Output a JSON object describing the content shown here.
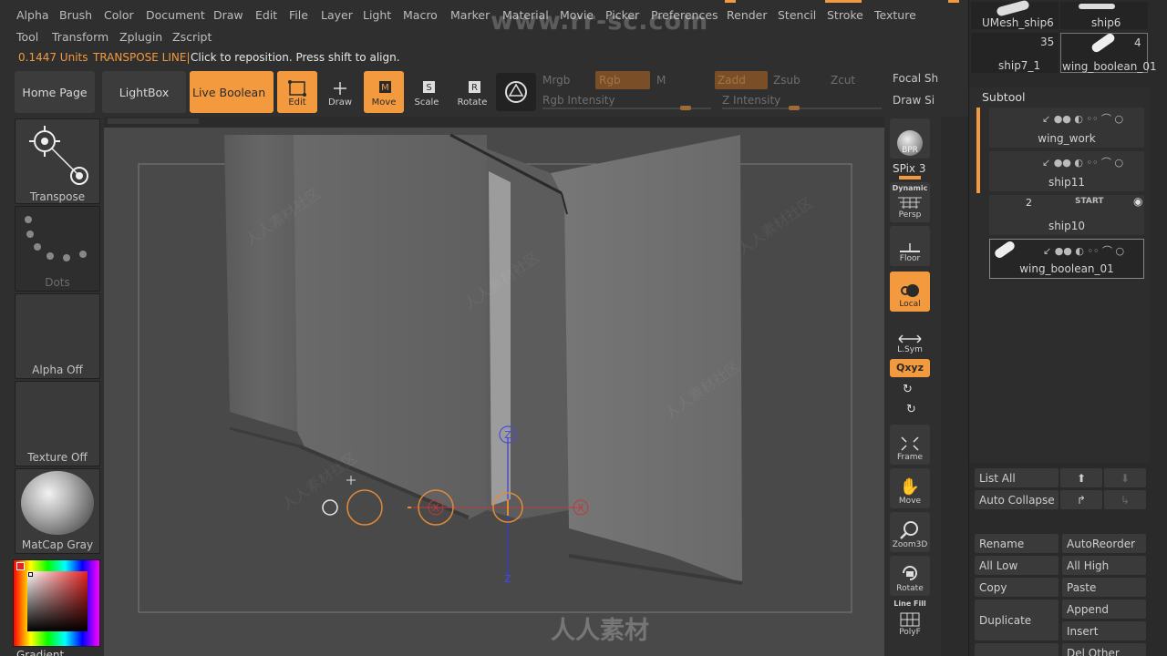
{
  "menu": {
    "row1": [
      "Alpha",
      "Brush",
      "Color",
      "Document",
      "Draw",
      "Edit",
      "File",
      "Layer",
      "Light",
      "Macro",
      "Marker",
      "Material",
      "Movie",
      "Picker",
      "Preferences",
      "Render",
      "Stencil",
      "Stroke",
      "Texture"
    ],
    "row2": [
      "Tool",
      "Transform",
      "Zplugin",
      "Zscript"
    ],
    "focal_label": "Focal Sh",
    "draw_size_label": "Draw Si"
  },
  "status": {
    "units": "0.1447 Units",
    "mode": "TRANSPOSE LINE|",
    "hint": "Click to reposition. Press shift to align."
  },
  "toolbar": {
    "home_page": "Home Page",
    "lightbox": "LightBox",
    "live_boolean": "Live Boolean",
    "edit": "Edit",
    "draw": "Draw",
    "move": "Move",
    "scale": "Scale",
    "rotate": "Rotate",
    "mrgb": "Mrgb",
    "rgb": "Rgb",
    "m": "M",
    "zadd": "Zadd",
    "zsub": "Zsub",
    "zcut": "Zcut",
    "rgb_intensity": "Rgb Intensity",
    "z_intensity": "Z Intensity",
    "rgb_intensity_level": 0.85,
    "z_intensity_level": 0.45
  },
  "left_shelf": {
    "transpose": "Transpose",
    "dots": "Dots",
    "alpha": "Alpha Off",
    "texture": "Texture Off",
    "matcap": "MatCap Gray",
    "gradient": "Gradient"
  },
  "right_shelf": {
    "bpr": "BPR",
    "spix": "SPix 3",
    "dynamic": "Dynamic",
    "persp": "Persp",
    "floor": "Floor",
    "local": "Local",
    "lsym": "L.Sym",
    "xyz": "Qxyz",
    "frame": "Frame",
    "move": "Move",
    "zoom3d": "Zoom3D",
    "rotate": "Rotate",
    "line_fill": "Line Fill",
    "polyf": "PolyF"
  },
  "viewport": {
    "axis_z_top": "Z",
    "axis_z_bottom": "Z",
    "axis_x_left": "X",
    "axis_x_right": "X"
  },
  "tray": {
    "recent": [
      {
        "name": "UMesh_ship6",
        "count": ""
      },
      {
        "name": "ship6",
        "count": ""
      },
      {
        "name": "ship7_1",
        "count": "35"
      },
      {
        "name": "wing_boolean_01",
        "count": "4"
      }
    ],
    "subtool_title": "Subtool",
    "subtools": [
      {
        "name": "wing_work",
        "badge": ""
      },
      {
        "name": "ship11",
        "badge": ""
      },
      {
        "name": "ship10",
        "badge": "2",
        "tag": "START"
      },
      {
        "name": "wing_boolean_01",
        "badge": ""
      }
    ],
    "list_all": "List All",
    "auto_collapse": "Auto Collapse",
    "rename": "Rename",
    "autoreorder": "AutoReorder",
    "all_low": "All Low",
    "all_high": "All High",
    "copy": "Copy",
    "paste": "Paste",
    "duplicate": "Duplicate",
    "append": "Append",
    "insert": "Insert",
    "del_other": "Del Other"
  },
  "watermark": {
    "top": "www.rr-sc.com",
    "bottom": "人人素材",
    "tile": "人人素材社区"
  },
  "colors": {
    "accent": "#f39a3f",
    "panel": "#2f2f2f",
    "viewport": "#494949"
  }
}
